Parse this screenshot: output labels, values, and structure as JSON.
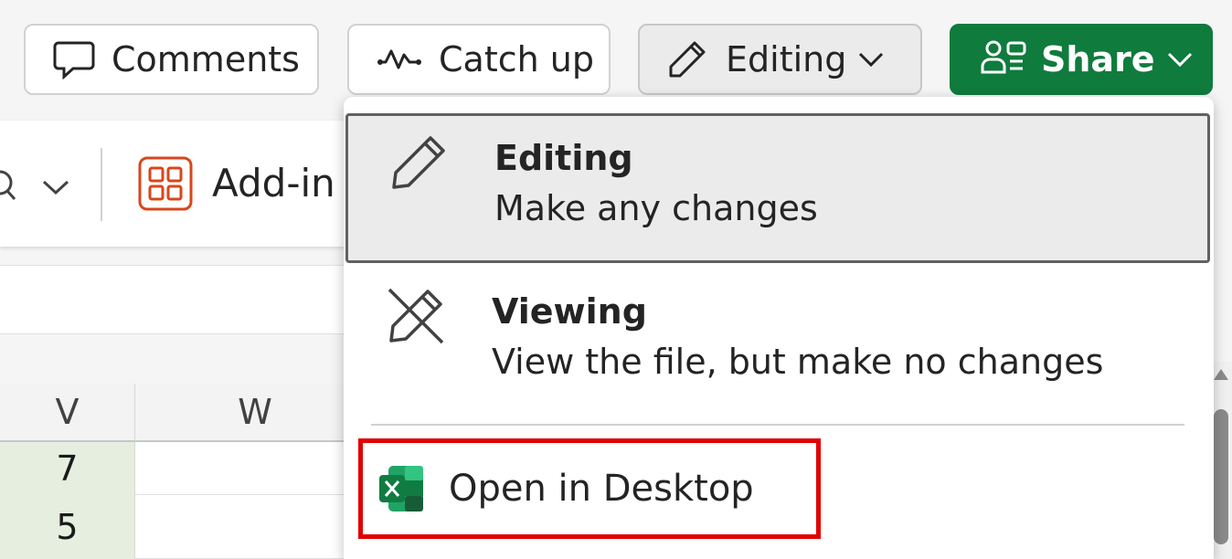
{
  "toolbar": {
    "comments_label": "Comments",
    "catchup_label": "Catch up",
    "editing_label": "Editing",
    "share_label": "Share"
  },
  "ribbon": {
    "addin_label": "Add-in"
  },
  "grid": {
    "columns": [
      "V",
      "W"
    ],
    "rows": [
      {
        "v": "7",
        "w": ""
      },
      {
        "v": "5",
        "w": ""
      }
    ]
  },
  "mode_menu": {
    "items": [
      {
        "title": "Editing",
        "description": "Make any changes",
        "icon": "pencil-icon",
        "selected": true
      },
      {
        "title": "Viewing",
        "description": "View the file, but make no changes",
        "icon": "pencil-off-icon",
        "selected": false
      }
    ],
    "open_desktop_label": "Open in Desktop"
  },
  "colors": {
    "share_green": "#0f7b3d",
    "highlight_red": "#e00000",
    "selected_cell_fill": "#e5eedf",
    "excel_green": "#107c41"
  }
}
